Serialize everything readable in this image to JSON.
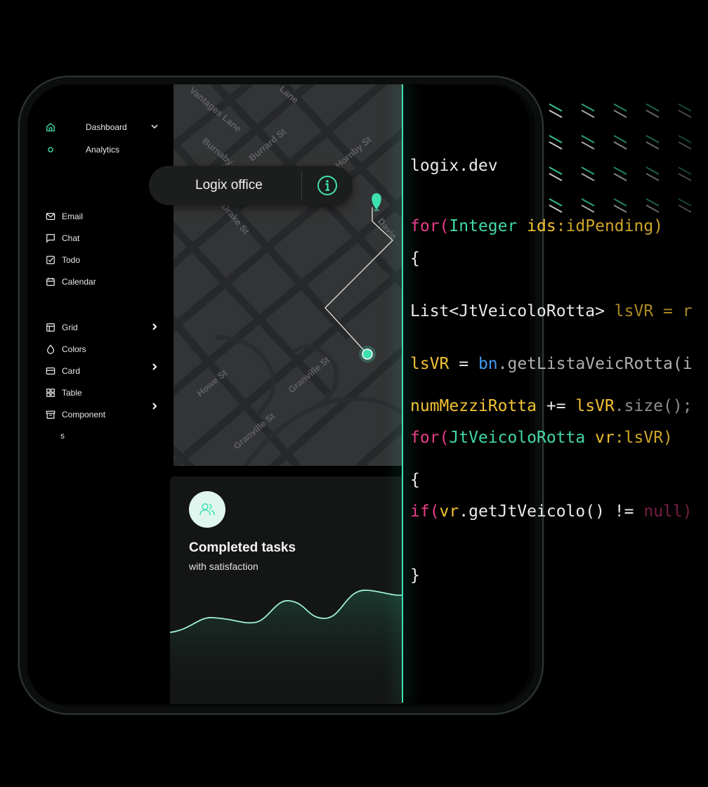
{
  "sidebar": {
    "top": [
      {
        "label": "Dashboard",
        "icon": "home-icon"
      },
      {
        "label": "Analytics",
        "icon": "circle-icon"
      }
    ],
    "apps": [
      {
        "label": "Email",
        "icon": "mail-icon"
      },
      {
        "label": "Chat",
        "icon": "chat-icon"
      },
      {
        "label": "Todo",
        "icon": "checkbox-icon"
      },
      {
        "label": "Calendar",
        "icon": "calendar-icon"
      }
    ],
    "ui": [
      {
        "label": "Grid",
        "icon": "grid-layout-icon"
      },
      {
        "label": "Colors",
        "icon": "droplet-icon"
      },
      {
        "label": "Card",
        "icon": "card-icon"
      },
      {
        "label": "Table",
        "icon": "table-icon"
      },
      {
        "label": "Component",
        "icon": "archive-icon"
      }
    ],
    "component_tail": "s"
  },
  "map": {
    "callout_title": "Logix office",
    "streets": [
      "Burrard St",
      "Hornby St",
      "Drake St",
      "Howe St",
      "Granville St",
      "Granville St",
      "Davie",
      "Burnaby",
      "Vantages Lane",
      "Lane"
    ],
    "accent": "#3fe0b0"
  },
  "card": {
    "title": "Completed tasks",
    "subtitle": "with satisfaction"
  },
  "code": {
    "domain": "logix.dev",
    "lines": [
      [
        "for(",
        "Integer ",
        "ids",
        ":idPending)"
      ],
      [
        "{"
      ],
      [
        "List<JtVeicoloRotta> ",
        "lsVR = r"
      ],
      [
        "lsVR",
        " = ",
        "bn",
        ".getListaVeicRotta(i"
      ],
      [
        "numMezziRotta",
        " += ",
        "lsVR",
        ".size();"
      ],
      [
        "for(",
        "JtVeicoloRotta ",
        "vr",
        ":lsVR)"
      ],
      [
        "{"
      ],
      [
        "if(",
        "vr",
        ".getJtVeicolo() != ",
        "null)"
      ],
      [
        "}"
      ]
    ],
    "colors": {
      "keyword": "#e83e8c",
      "type": "#43d8a7",
      "var": "#f2c230",
      "plain": "#e9e9e9",
      "blue": "#3e9bf0"
    }
  }
}
